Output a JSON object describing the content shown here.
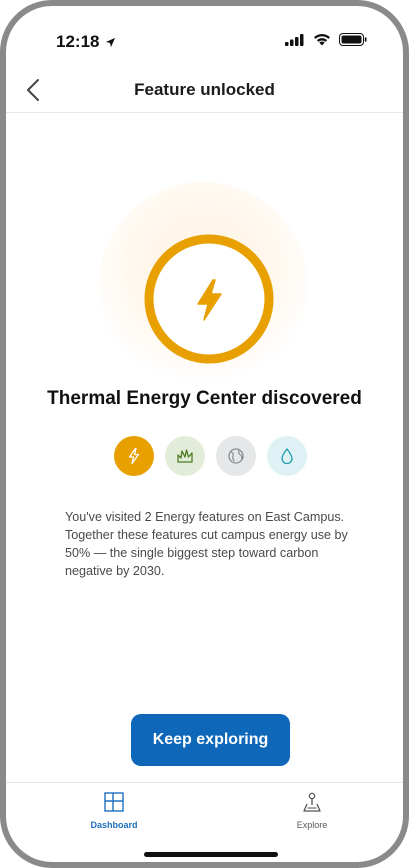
{
  "status_bar": {
    "time": "12:18"
  },
  "nav": {
    "title": "Feature unlocked"
  },
  "badge": {
    "icon": "lightning-bolt-icon",
    "accent_color": "#e8a000"
  },
  "headline": "Thermal Energy Center discovered",
  "category_chips": [
    {
      "icon": "lightning-icon",
      "category": "energy"
    },
    {
      "icon": "grass-icon",
      "category": "nature"
    },
    {
      "icon": "globe-icon",
      "category": "global"
    },
    {
      "icon": "water-drop-icon",
      "category": "water"
    }
  ],
  "description": "You've visited 2 Energy features on East Campus. Together these features cut campus energy use by 50% — the single biggest step toward carbon negative by 2030.",
  "cta": {
    "label": "Keep exploring",
    "color": "#0e67b8"
  },
  "tabbar": {
    "items": [
      {
        "label": "Dashboard",
        "icon": "dashboard-icon",
        "active": true
      },
      {
        "label": "Explore",
        "icon": "explore-icon",
        "active": false
      }
    ]
  }
}
